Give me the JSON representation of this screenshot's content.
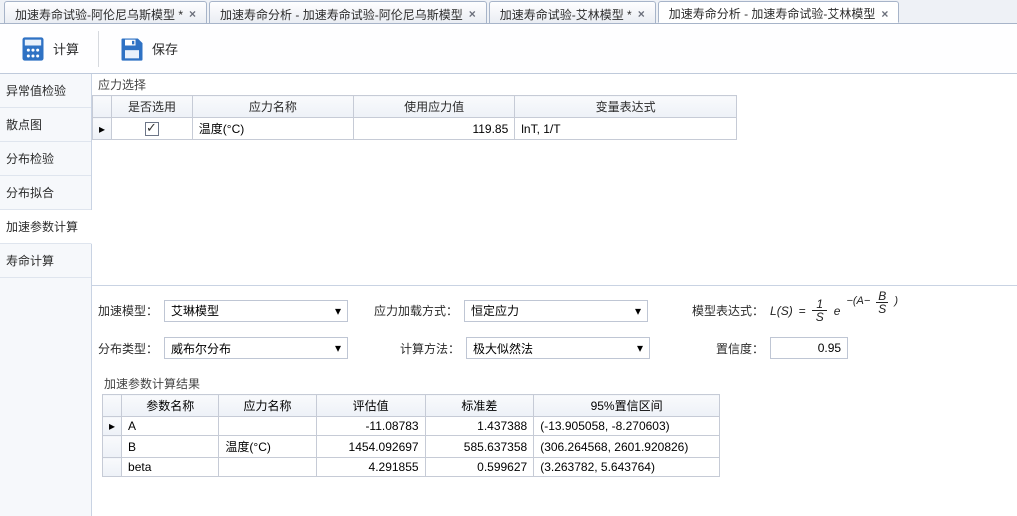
{
  "tabs": [
    {
      "label": "加速寿命试验-阿伦尼乌斯模型 *",
      "active": false
    },
    {
      "label": "加速寿命分析 - 加速寿命试验-阿伦尼乌斯模型",
      "active": false
    },
    {
      "label": "加速寿命试验-艾林模型 *",
      "active": false
    },
    {
      "label": "加速寿命分析 - 加速寿命试验-艾林模型",
      "active": true
    }
  ],
  "toolbar": {
    "compute": "计算",
    "save": "保存"
  },
  "sidebar": {
    "items": [
      "异常值检验",
      "散点图",
      "分布检验",
      "分布拟合",
      "加速参数计算",
      "寿命计算"
    ],
    "active_index": 4
  },
  "stress_panel": {
    "title": "应力选择",
    "head": {
      "sel": "是否选用",
      "name": "应力名称",
      "val": "使用应力值",
      "expr": "变量表达式"
    },
    "row": {
      "selected": true,
      "name": "温度(°C)",
      "val": "119.85",
      "expr": "lnT, 1/T"
    }
  },
  "form": {
    "model_label": "加速模型：",
    "model_value": "艾琳模型",
    "load_label": "应力加载方式：",
    "load_value": "恒定应力",
    "dist_label": "分布类型：",
    "dist_value": "威布尔分布",
    "method_label": "计算方法：",
    "method_value": "极大似然法",
    "formula_label": "模型表达式：",
    "conf_label": "置信度：",
    "conf_value": "0.95"
  },
  "results": {
    "title": "加速参数计算结果",
    "head": {
      "p": "参数名称",
      "s": "应力名称",
      "est": "评估值",
      "se": "标准差",
      "ci": "95%置信区间"
    },
    "rows": [
      {
        "p": "A",
        "s": "",
        "est": "-11.08783",
        "se": "1.437388",
        "ci": "(-13.905058, -8.270603)"
      },
      {
        "p": "B",
        "s": "温度(°C)",
        "est": "1454.092697",
        "se": "585.637358",
        "ci": "(306.264568, 2601.920826)"
      },
      {
        "p": "beta",
        "s": "",
        "est": "4.291855",
        "se": "0.599627",
        "ci": "(3.263782, 5.643764)"
      }
    ]
  }
}
